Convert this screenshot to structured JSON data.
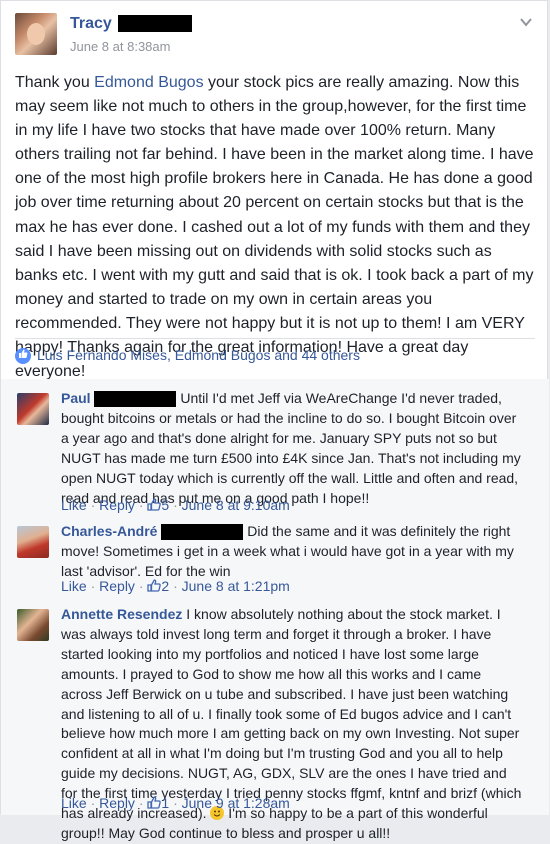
{
  "post": {
    "author": "Tracy",
    "time": "June 8 at 8:38am",
    "text_before": "Thank you ",
    "mention": "Edmond Bugos",
    "text_after": " your stock pics are really amazing. Now this may seem like not much to others in the group,however, for the first time in my life I have two stocks that have made over 100% return. Many others trailing not far behind. I have been in the market along time. I have one of the most high profile brokers here in Canada. He has done a good job over time returning about 20 percent on certain stocks but that is the max he has ever done. I cashed out a lot of my funds with them and they said I have been missing out on dividends with solid stocks such as banks etc. I went with my gutt and said that is ok. I took back a part of my money and started to trade on my own in certain areas you recommended. They were not happy but it is not up to them! I am VERY happy! Thanks again for the great information! Have a great day everyone!"
  },
  "reactions": {
    "text": "Luis Fernando Mises, Edmond Bugos and 44 others"
  },
  "comments": [
    {
      "name": "Paul",
      "text": "Until I'd met Jeff via WeAreChange I'd never traded, bought bitcoins or metals or had the incline to do so. I bought Bitcoin over a year ago and that's done alright for me. January SPY puts not so but NUGT has made me turn £500 into £4K since Jan. That's not including my open NUGT today which is currently off the wall. Little and often and read, read and read has put me on a good path I hope!!",
      "like": "Like",
      "reply": "Reply",
      "likes": "5",
      "time": "June 8 at 9:10am"
    },
    {
      "name": "Charles-André",
      "text": "Did the same and it was definitely the right move! Sometimes i get in a week what i would have got in a year with my last 'advisor'. Ed for the win",
      "like": "Like",
      "reply": "Reply",
      "likes": "2",
      "time": "June 8 at 1:21pm"
    },
    {
      "name": "Annette Resendez",
      "text_before": " I know absolutely nothing about the stock market. I was always told invest long term and forget it through a broker. I have started looking into my portfolios and noticed I have lost some large amounts. I prayed to God to show me how all this works and I came across Jeff Berwick on u tube and subscribed. I have just been watching and listening to all of u. I finally took some of Ed bugos advice and I can't believe how much more I am getting back on my own Investing. Not super confident at all in what I'm doing but I'm trusting God and you all to help guide my decisions. NUGT, AG, GDX, SLV are the ones I have tried and for the first time yesterday I tried penny stocks ffgmf, kntnf and brizf (which has already increased). ",
      "text_after": " I'm so happy to be a part of this wonderful group!! May God continue to bless and prosper u all!!",
      "like": "Like",
      "reply": "Reply",
      "likes": "1",
      "time": "June 9 at 1:28am"
    }
  ],
  "colors": {
    "link": "#365899",
    "text": "#1d2129",
    "meta": "#90949c",
    "comment_bg": "#f6f7f9"
  },
  "icons": {
    "chevron": "chevron-down-icon",
    "like_badge": "like-badge-icon",
    "thumb": "thumbs-up-icon",
    "emoji": "smiley-emoji-icon"
  }
}
